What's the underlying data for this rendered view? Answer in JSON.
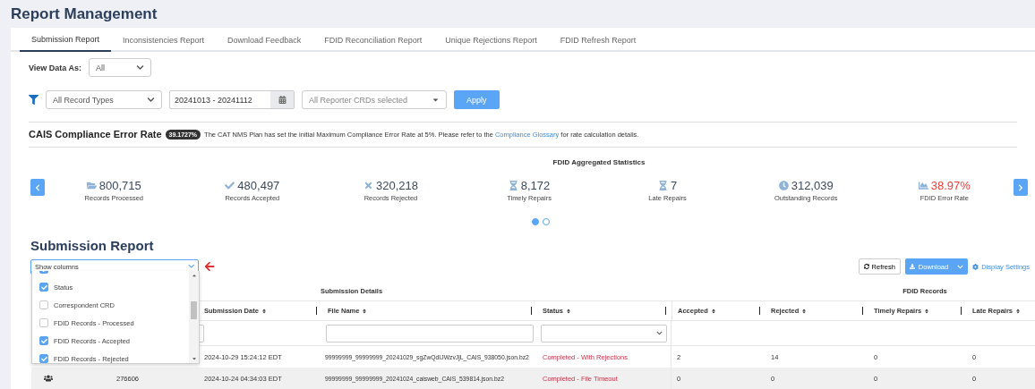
{
  "page_title": "Report Management",
  "tabs": [
    {
      "label": "Submission Report",
      "selected": true
    },
    {
      "label": "Inconsistencies Report",
      "selected": false
    },
    {
      "label": "Download Feedback",
      "selected": false
    },
    {
      "label": "FDID Reconciliation Report",
      "selected": false
    },
    {
      "label": "Unique Rejections Report",
      "selected": false
    },
    {
      "label": "FDID Refresh Report",
      "selected": false
    }
  ],
  "view_data": {
    "label": "View Data As:",
    "value": "All"
  },
  "filters": {
    "record_type": "All Record Types",
    "date_range": "20241013 - 20241112",
    "reporter_crds": "All Reporter CRDs selected",
    "apply": "Apply"
  },
  "compliance": {
    "title": "CAIS Compliance Error Rate",
    "badge": "39.1727%",
    "text_before": "The CAT NMS Plan has set the initial Maximum Compliance Error Rate at 5%. Please refer to the",
    "link": "Compliance Glossary",
    "text_after": "for rate calculation details."
  },
  "stats_title": "FDID Aggregated Statistics",
  "stats": [
    {
      "kind": "folder",
      "value": "800,715",
      "label": "Records Processed",
      "alert": false
    },
    {
      "kind": "check",
      "value": "480,497",
      "label": "Records Accepted",
      "alert": false
    },
    {
      "kind": "cross",
      "value": "320,218",
      "label": "Records Rejected",
      "alert": false
    },
    {
      "kind": "hourglass",
      "value": "8,172",
      "label": "Timely Repairs",
      "alert": false
    },
    {
      "kind": "hourglass",
      "value": "7",
      "label": "Late Repairs",
      "alert": false
    },
    {
      "kind": "clock",
      "value": "312,039",
      "label": "Outstanding Records",
      "alert": false
    },
    {
      "kind": "chart",
      "value": "38.97%",
      "label": "FDID Error Rate",
      "alert": true
    }
  ],
  "carousel_dots": [
    {
      "selected": true
    },
    {
      "selected": false
    }
  ],
  "report_title": "Submission Report",
  "show_columns": {
    "placeholder": "Show columns",
    "expanded": true,
    "partial_item": {
      "checked": true
    },
    "items": [
      {
        "label": "Status",
        "checked": true
      },
      {
        "label": "Correspondent CRD",
        "checked": false
      },
      {
        "label": "FDID Records - Processed",
        "checked": false
      },
      {
        "label": "FDID Records - Accepted",
        "checked": true
      },
      {
        "label": "FDID Records - Rejected",
        "checked": true
      }
    ]
  },
  "toolbar": {
    "refresh": "Refresh",
    "download": "Download",
    "display_settings": "Display Settings"
  },
  "table": {
    "groups": [
      "Submission Details",
      "FDID Records"
    ],
    "columns": [
      "Submission Date",
      "File Name",
      "Status",
      "Accepted",
      "Rejected",
      "Timely Repairs",
      "Late Repairs"
    ],
    "rows": [
      {
        "selected": false,
        "cells": [
          "2024-10-29 15:24:12 EDT",
          "99999999_99999999_20241029_sgZwQdIJWzvJjL_CAIS_938050.json.bz2",
          "Completed - With Rejections",
          "2",
          "14",
          "0",
          "0"
        ]
      },
      {
        "selected": true,
        "icon": true,
        "id": "276606",
        "cells": [
          "2024-10-24 04:34:03 EDT",
          "99999999_99999999_20241024_caisweb_CAIS_539814.json.bz2",
          "Completed - File Timeout",
          "0",
          "0",
          "0",
          "0"
        ]
      }
    ]
  }
}
